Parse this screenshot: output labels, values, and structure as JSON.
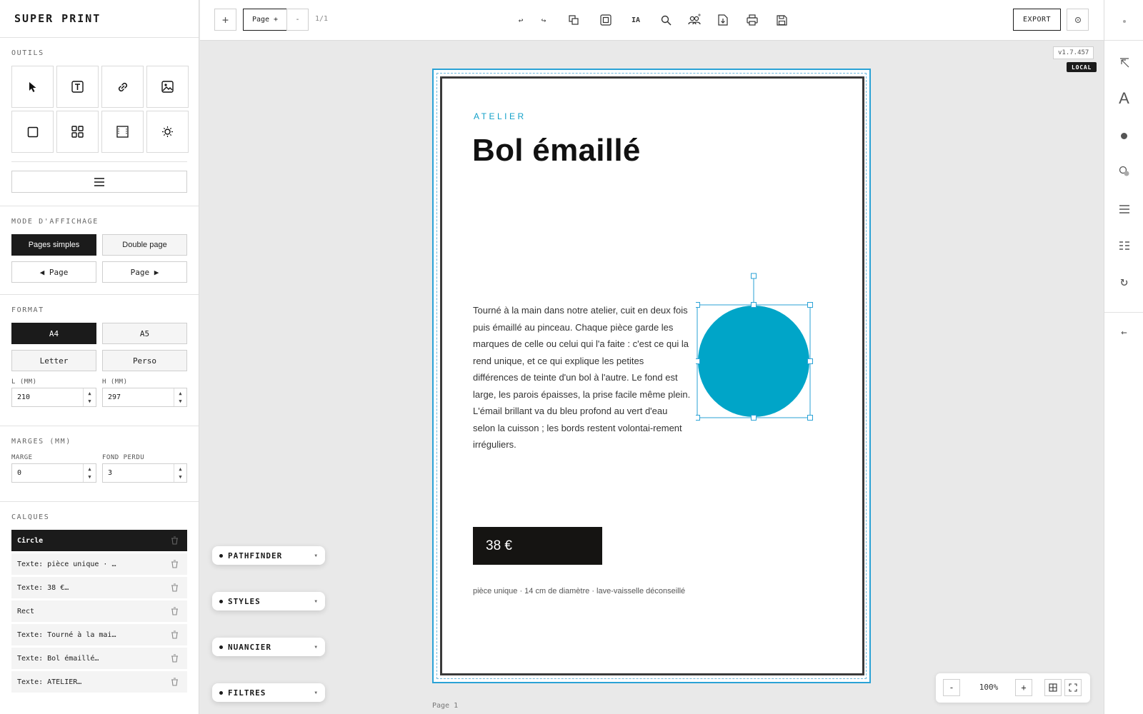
{
  "app": {
    "title": "SUPER PRINT"
  },
  "tools": {
    "title": "OUTILS",
    "items": [
      "cursor-icon",
      "text-tool-icon",
      "link-icon",
      "image-icon",
      "rectangle-icon",
      "grid-icon",
      "frame-icon",
      "sun-icon"
    ],
    "align_icon": "menu-lines-icon"
  },
  "display_mode": {
    "title": "MODE D'AFFICHAGE",
    "single": "Pages simples",
    "double": "Double page",
    "active": "Pages simples",
    "prev_page": "◀ Page",
    "next_page": "Page ▶"
  },
  "format": {
    "title": "FORMAT",
    "options": [
      "A4",
      "A5",
      "Letter",
      "Perso"
    ],
    "active": "A4",
    "width_label": "L (MM)",
    "height_label": "H (MM)",
    "width": "210",
    "height": "297"
  },
  "margins": {
    "title": "MARGES (MM)",
    "margin_label": "MARGE",
    "bleed_label": "FOND PERDU",
    "margin": "0",
    "bleed": "3"
  },
  "layers": {
    "title": "CALQUES",
    "items": [
      "Circle",
      "Texte: pièce unique · …",
      "Texte: 38 €…",
      "Rect",
      "Texte: Tourné à la mai…",
      "Texte: Bol émaillé…",
      "Texte: ATELIER…"
    ],
    "selected": "Circle"
  },
  "toolbar": {
    "add": "+",
    "page_add": "Page +",
    "page_remove": "-",
    "page_count": "1/1",
    "export": "EXPORT",
    "icons": [
      "undo-icon",
      "redo-icon",
      "duplicate-icon",
      "frame-select-icon",
      "ai-icon",
      "search-icon",
      "collaborators-icon",
      "import-icon",
      "print-icon",
      "save-icon",
      "settings-icon"
    ],
    "ai_label": "IA"
  },
  "version": {
    "number": "v1.7.457",
    "badge": "LOCAL"
  },
  "document": {
    "eyebrow": "ATELIER",
    "title": "Bol émaillé",
    "body": "Tourné à la main dans notre atelier, cuit en deux fois puis émaillé au pinceau. Chaque pièce garde les marques de celle ou celui qui l'a faite : c'est ce qui la rend unique, et ce qui explique les petites différences de teinte d'un bol à l'autre. Le fond est large, les parois épaisses, la prise facile même plein. L'émail brillant va du bleu profond au vert d'eau selon la cuisson ; les bords restent volontai-rement irréguliers.",
    "price": "38 €",
    "footnote": "pièce unique · 14 cm de diamètre · lave-vaisselle déconseillé",
    "circle_color": "#00a5c8",
    "accent_color": "#13a1c9",
    "page_label": "Page 1"
  },
  "floating_panels": [
    "PATHFINDER",
    "STYLES",
    "NUANCIER",
    "FILTRES"
  ],
  "zoom": {
    "minus": "-",
    "value": "100%",
    "plus": "+"
  },
  "right_rail": {
    "icons": [
      "collapse-arrow-icon",
      "typography-icon",
      "fill-dot-icon",
      "stroke-circle-icon",
      "align-lines-icon",
      "list-columns-icon",
      "refresh-icon",
      "back-arrow-icon"
    ],
    "typography_glyph": "A"
  }
}
